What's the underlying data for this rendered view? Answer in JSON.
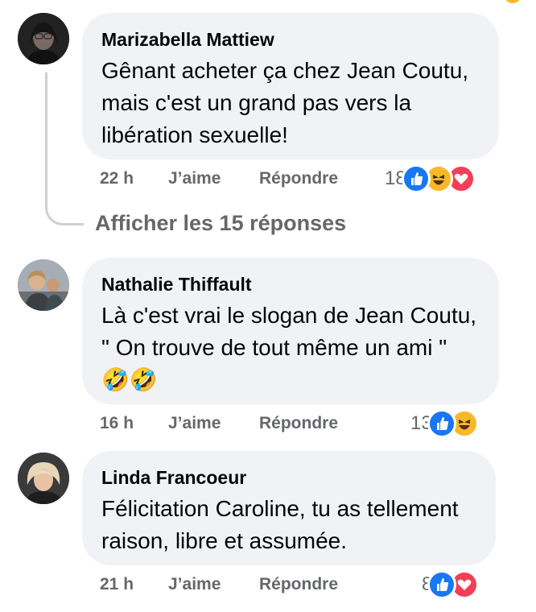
{
  "comments": [
    {
      "author": "Marizabella Mattiew",
      "text": "Gênant acheter ça chez Jean Coutu, mais c'est un grand pas vers la libération sexuelle!",
      "time": "22 h",
      "like_label": "J’aime",
      "reply_label": "Répondre",
      "reaction_count": "18",
      "reactions": [
        "like-icon",
        "haha-icon",
        "love-icon"
      ]
    },
    {
      "author": "Nathalie Thiffault",
      "text": "Là c'est vrai le slogan de Jean Coutu, \" On trouve de tout même un ami \" 🤣🤣",
      "time": "16 h",
      "like_label": "J’aime",
      "reply_label": "Répondre",
      "reaction_count": "13",
      "reactions": [
        "like-icon",
        "haha-icon"
      ]
    },
    {
      "author": "Linda Francoeur",
      "text": "Félicitation Caroline, tu as tellement raison, libre et assumée.",
      "time": "21 h",
      "like_label": "J’aime",
      "reply_label": "Répondre",
      "reaction_count": "8",
      "reactions": [
        "like-icon",
        "love-icon"
      ]
    }
  ],
  "replies_link": "Afficher les 15 réponses",
  "colors": {
    "like": "#1877f2",
    "haha": "#f7b928",
    "love": "#f33e58",
    "bubble": "#f0f2f5",
    "meta": "#65676b"
  }
}
